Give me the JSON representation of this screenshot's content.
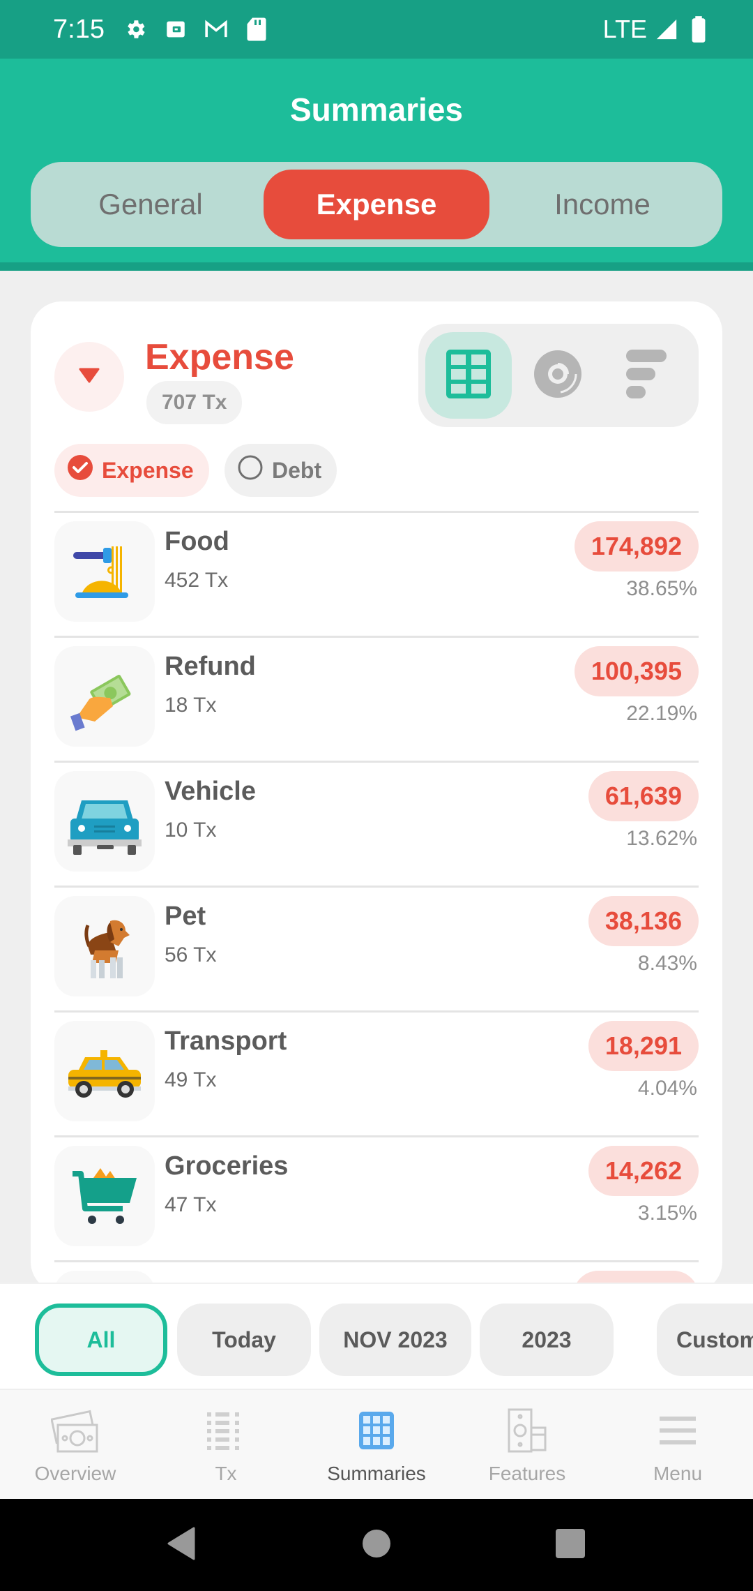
{
  "status_bar": {
    "time": "7:15",
    "left_icons": [
      "gear-icon",
      "wallet-icon",
      "gmail-icon",
      "sd-card-icon"
    ],
    "network": "LTE",
    "right_icons": [
      "signal-icon",
      "battery-icon"
    ]
  },
  "header": {
    "title": "Summaries",
    "tabs": [
      {
        "label": "General",
        "active": false
      },
      {
        "label": "Expense",
        "active": true
      },
      {
        "label": "Income",
        "active": false
      }
    ]
  },
  "summary_card": {
    "title": "Expense",
    "tx_count": "707 Tx",
    "view_modes": [
      {
        "icon": "grid-icon",
        "active": true
      },
      {
        "icon": "donut-chart-icon",
        "active": false
      },
      {
        "icon": "bar-list-icon",
        "active": false
      }
    ],
    "filters": [
      {
        "label": "Expense",
        "checked": true
      },
      {
        "label": "Debt",
        "checked": false
      }
    ],
    "categories": [
      {
        "name": "Food",
        "tx": "452 Tx",
        "amount": "174,892",
        "percent": "38.65%",
        "icon": "food-icon"
      },
      {
        "name": "Refund",
        "tx": "18 Tx",
        "amount": "100,395",
        "percent": "22.19%",
        "icon": "cash-hand-icon"
      },
      {
        "name": "Vehicle",
        "tx": "10 Tx",
        "amount": "61,639",
        "percent": "13.62%",
        "icon": "car-icon"
      },
      {
        "name": "Pet",
        "tx": "56 Tx",
        "amount": "38,136",
        "percent": "8.43%",
        "icon": "dog-icon"
      },
      {
        "name": "Transport",
        "tx": "49 Tx",
        "amount": "18,291",
        "percent": "4.04%",
        "icon": "taxi-icon"
      },
      {
        "name": "Groceries",
        "tx": "47 Tx",
        "amount": "14,262",
        "percent": "3.15%",
        "icon": "cart-icon"
      }
    ]
  },
  "period_filter": {
    "options": [
      {
        "label": "All",
        "active": true
      },
      {
        "label": "Today",
        "active": false
      },
      {
        "label": "NOV 2023",
        "active": false
      },
      {
        "label": "2023",
        "active": false
      },
      {
        "label": "Custom",
        "active": false
      }
    ]
  },
  "bottom_nav": {
    "items": [
      {
        "label": "Overview",
        "icon": "money-icon",
        "active": false
      },
      {
        "label": "Tx",
        "icon": "list-icon",
        "active": false
      },
      {
        "label": "Summaries",
        "icon": "grid-icon",
        "active": true
      },
      {
        "label": "Features",
        "icon": "features-icon",
        "active": false
      },
      {
        "label": "Menu",
        "icon": "menu-icon",
        "active": false
      }
    ]
  },
  "colors": {
    "primary": "#1dbd9a",
    "primary_dark": "#17a085",
    "expense": "#e74c3c",
    "nav_active": "#5aa9ec"
  }
}
